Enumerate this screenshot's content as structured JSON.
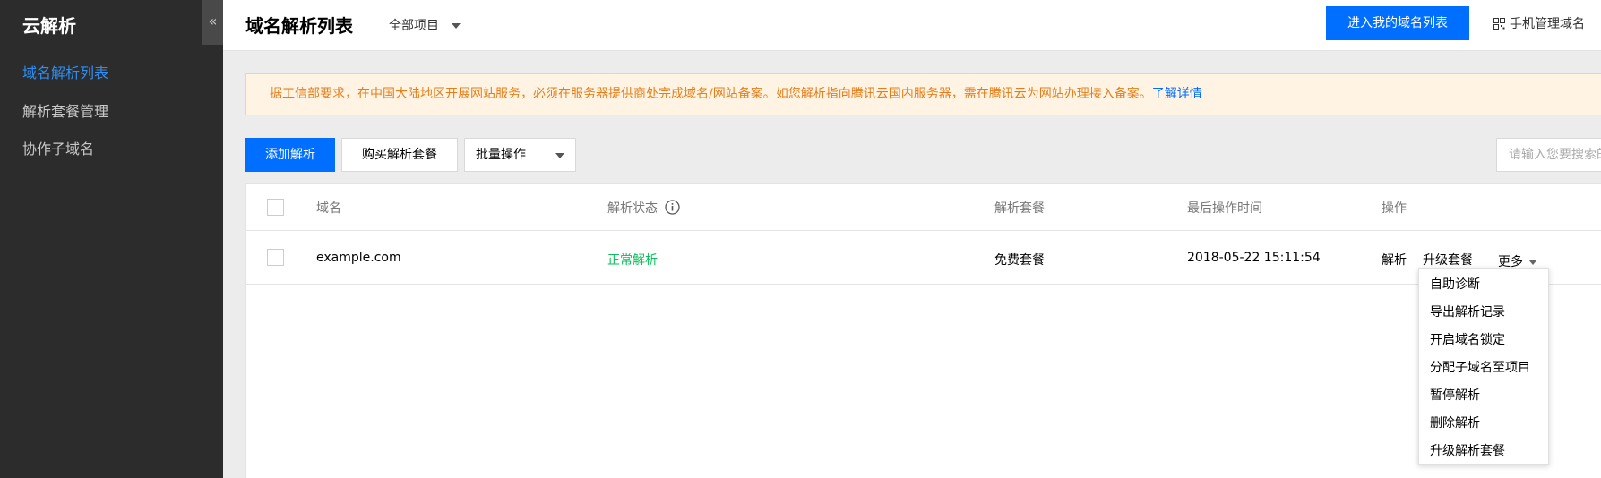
{
  "sidebar": {
    "brand": "云解析",
    "collapse_glyph": "«",
    "items": [
      {
        "label": "域名解析列表",
        "active": true
      },
      {
        "label": "解析套餐管理",
        "active": false
      },
      {
        "label": "协作子域名",
        "active": false
      }
    ]
  },
  "header": {
    "title": "域名解析列表",
    "project_select": "全部项目",
    "enter_domain_list": "进入我的域名列表",
    "mobile_manage": "手机管理域名"
  },
  "notice": {
    "text": "据工信部要求，在中国大陆地区开展网站服务，必须在服务器提供商处完成域名/网站备案。如您解析指向腾讯云国内服务器，需在腾讯云为网站办理接入备案。",
    "link": "了解详情"
  },
  "toolbar": {
    "add_record": "添加解析",
    "buy_package": "购买解析套餐",
    "batch_ops": "批量操作",
    "search_placeholder": "请输入您要搜索的域名"
  },
  "table": {
    "columns": [
      "域名",
      "解析状态",
      "解析套餐",
      "最后操作时间",
      "操作"
    ],
    "rows": [
      {
        "domain": "example.com",
        "status": "正常解析",
        "package": "免费套餐",
        "last_op_time": "2018-05-22 15:11:54",
        "actions": {
          "resolve": "解析",
          "upgrade": "升级套餐",
          "more": "更多"
        }
      }
    ]
  },
  "more_menu": {
    "items": [
      "自助诊断",
      "导出解析记录",
      "开启域名锁定",
      "分配子域名至项目",
      "暂停解析",
      "删除解析",
      "升级解析套餐"
    ]
  },
  "colors": {
    "primary": "#006eff",
    "sidebar_bg": "#2c2c2c",
    "status_ok": "#0abf5b",
    "notice_text": "#e57e1a"
  }
}
